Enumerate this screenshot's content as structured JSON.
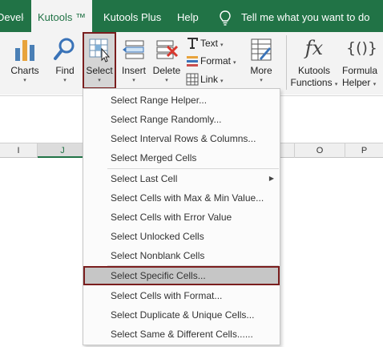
{
  "tabs": {
    "developer": "Developer",
    "kutools": "Kutools ™",
    "kutools_plus": "Kutools Plus",
    "help": "Help",
    "tell_me": "Tell me what you want to do"
  },
  "ribbon": {
    "charts": "Charts",
    "find": "Find",
    "select": "Select",
    "insert": "Insert",
    "delete": "Delete",
    "text": "Text",
    "format": "Format",
    "link": "Link",
    "more": "More",
    "kutools_functions": [
      "Kutools",
      "Functions"
    ],
    "formula_helper": [
      "Formula",
      "Helper"
    ],
    "fx_symbol": "fx",
    "braces_symbol": "{()}",
    "dropdown_arrow": "▾"
  },
  "columns": [
    "I",
    "J",
    "O",
    "P"
  ],
  "selected_column": "J",
  "menu": {
    "items": [
      "Select Range Helper...",
      "Select Range Randomly...",
      "Select Interval Rows & Columns...",
      "Select Merged Cells",
      "Select Last Cell",
      "Select Cells with Max & Min Value...",
      "Select Cells with Error Value",
      "Select Unlocked Cells",
      "Select Nonblank Cells",
      "Select Specific Cells...",
      "Select Cells with Format...",
      "Select Duplicate & Unique Cells...",
      "Select Same & Different Cells......"
    ],
    "highlighted_item": "Select Specific Cells...",
    "submenu_arrow": "▶"
  },
  "colors": {
    "ribbon_green": "#217346",
    "highlight_border": "#7a1e1e",
    "highlight_fill": "#c6c6c6"
  },
  "icons": [
    "charts-icon",
    "find-icon",
    "select-icon",
    "insert-icon",
    "delete-icon",
    "text-icon",
    "format-icon",
    "link-icon",
    "more-icon",
    "lightbulb-icon"
  ]
}
